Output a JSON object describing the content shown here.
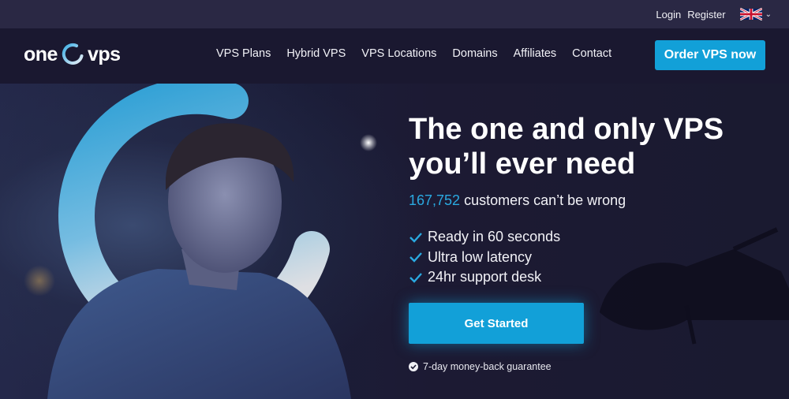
{
  "topbar": {
    "login": "Login",
    "register": "Register",
    "language_icon": "uk-flag-icon"
  },
  "nav": {
    "logo_left": "one",
    "logo_right": "vps",
    "items": [
      "VPS Plans",
      "Hybrid VPS",
      "VPS Locations",
      "Domains",
      "Affiliates",
      "Contact"
    ],
    "order_button": "Order VPS now"
  },
  "hero": {
    "headline_line1": "The one and only VPS",
    "headline_line2": "you’ll ever need",
    "customer_count": "167,752",
    "customer_text": " customers can’t be wrong",
    "features": [
      "Ready in 60 seconds",
      "Ultra low latency",
      "24hr support desk"
    ],
    "cta_label": "Get Started",
    "guarantee": "7-day money-back guarantee"
  },
  "colors": {
    "accent": "#12a0d8",
    "topbar_bg": "#2a2844",
    "nav_bg": "#1a1830",
    "hero_bg": "#1c1a33"
  }
}
